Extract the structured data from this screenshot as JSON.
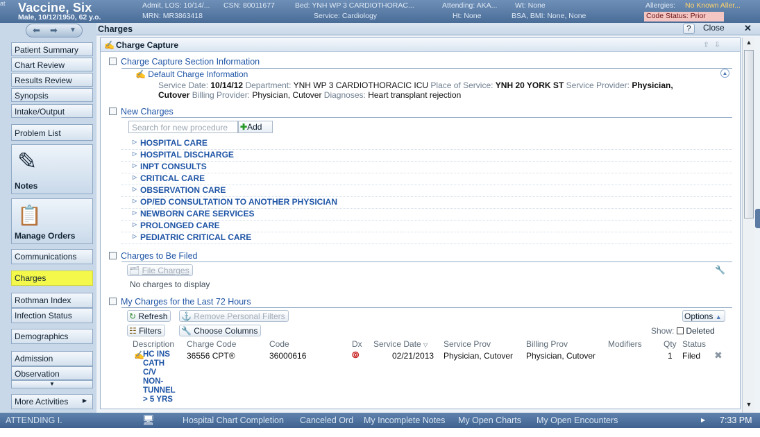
{
  "header": {
    "timestamp_fragment": "at",
    "patient_name": "Vaccine, Six",
    "patient_demo": "Male, 10/12/1950, 62 y.o.",
    "admit": "Admit, LOS: 10/14/...",
    "csn": "CSN: 80011677",
    "mrn": "MRN: MR3863418",
    "bed": "Bed: YNH WP 3 CARDIOTHORAC...",
    "service": "Service: Cardiology",
    "attending": "Attending: AKA...",
    "wt": "Wt: None",
    "ht": "Ht: None",
    "bsa": "BSA, BMI: None, None",
    "allergies_label": "Allergies:",
    "allergies_value": "No Known Aller...",
    "code_status": "Code Status: Prior"
  },
  "sidebar": {
    "items": [
      "Patient Summary",
      "Chart Review",
      "Results Review",
      "Synopsis",
      "Intake/Output",
      "Problem List"
    ],
    "notes_label": "Notes",
    "manage_orders_label": "Manage Orders",
    "items2": [
      "Communications",
      "Charges",
      "Rothman Index",
      "Infection Status",
      "Demographics",
      "Admission",
      "Observation"
    ],
    "more_activities": "More Activities"
  },
  "charges_window": {
    "title": "Charges",
    "help_label": "?",
    "close_label": "Close",
    "capture_title": "Charge Capture",
    "section_info": "Charge Capture Section Information",
    "default_info": "Default Charge Information",
    "service_date_label": "Service Date:",
    "service_date": "10/14/12",
    "department_label": "Department:",
    "department": "YNH WP 3 CARDIOTHORACIC ICU",
    "place_label": "Place of Service:",
    "place": "YNH 20 YORK ST",
    "service_provider_label": "Service Provider:",
    "service_provider_a": "Physician,",
    "service_provider_b": "Cutover",
    "billing_provider_label": "Billing Provider:",
    "billing_provider": "Physician, Cutover",
    "diagnoses_label": "Diagnoses:",
    "diagnoses": "Heart transplant rejection",
    "new_charges": "New Charges",
    "search_placeholder": "Search for new procedure",
    "add_label": "Add",
    "categories": [
      "HOSPITAL CARE",
      "HOSPITAL DISCHARGE",
      "INPT CONSULTS",
      "CRITICAL CARE",
      "OBSERVATION CARE",
      "OP/ED CONSULTATION TO ANOTHER PHYSICIAN",
      "NEWBORN CARE SERVICES",
      "PROLONGED CARE",
      "PEDIATRIC CRITICAL CARE"
    ],
    "to_be_filed": "Charges to Be Filed",
    "file_charges": "File Charges",
    "no_charges": "No charges to display",
    "last72": "My Charges for the Last 72 Hours",
    "refresh": "Refresh",
    "remove_filters": "Remove Personal Filters",
    "options": "Options",
    "filters": "Filters",
    "choose_columns": "Choose Columns",
    "show_label": "Show:",
    "deleted_label": "Deleted",
    "columns": [
      "Description",
      "Charge Code",
      "Code",
      "Dx",
      "Service Date",
      "Service Prov",
      "Billing Prov",
      "Modifiers",
      "Qty",
      "Status"
    ],
    "row": {
      "description_lines": [
        "HC INS",
        "CATH",
        "C/V",
        "NON-",
        "TUNNEL",
        "> 5 YRS"
      ],
      "charge_code": "36556 CPT®",
      "code": "36000616",
      "service_date": "02/21/2013",
      "service_prov": "Physician, Cutover",
      "billing_prov": "Physician, Cutover",
      "qty": "1",
      "status": "Filed"
    }
  },
  "status_bar": {
    "attending": "ATTENDING I.",
    "links": [
      "Hospital Chart Completion",
      "Canceled Ord",
      "My Incomplete Notes",
      "My Open Charts",
      "My Open Encounters"
    ],
    "time": "7:33 PM"
  },
  "colors": {
    "highlight": "#f3f84a",
    "link": "#1f55a6",
    "header": "#4a6d98"
  }
}
